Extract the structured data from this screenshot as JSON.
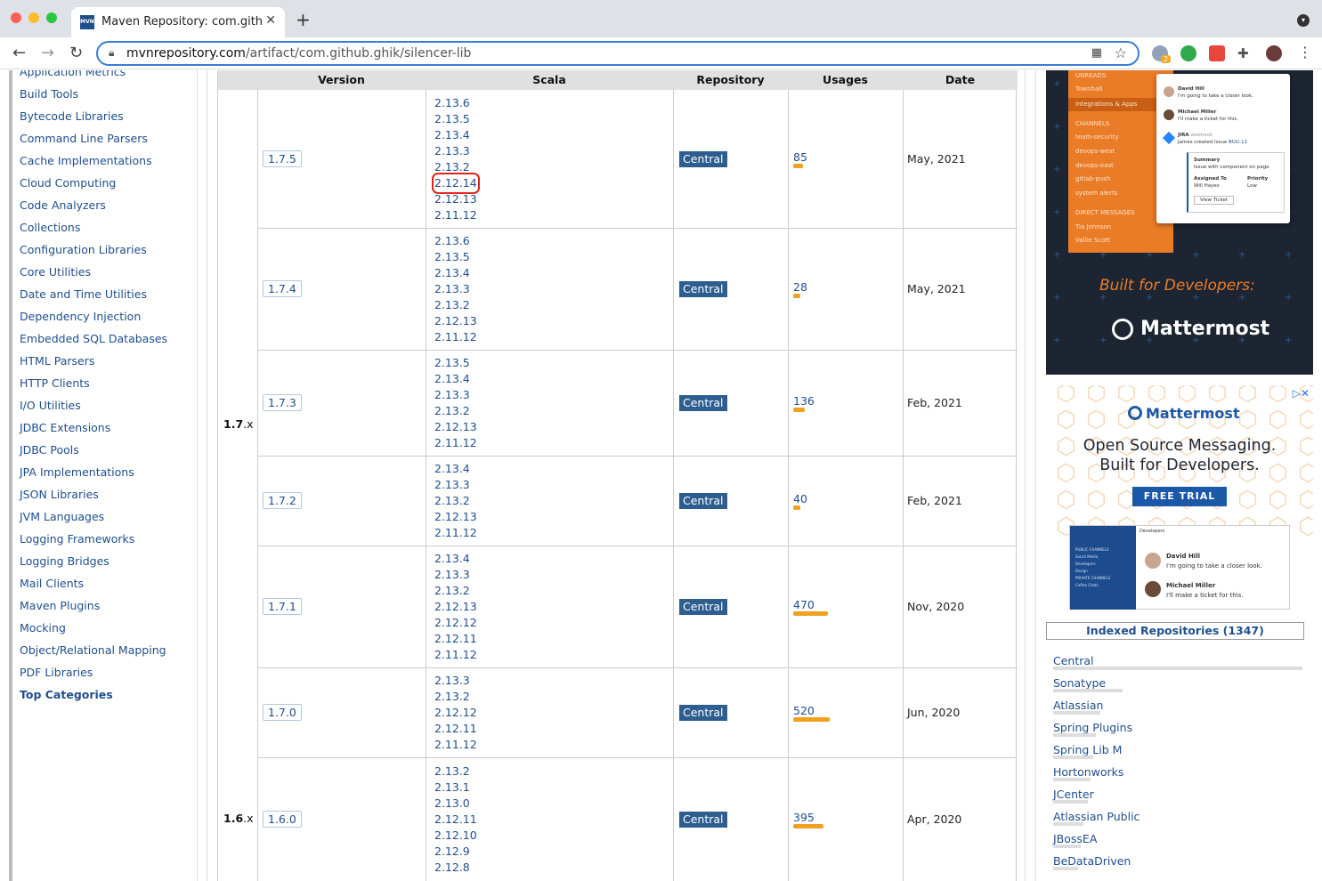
{
  "browser": {
    "tab_title": "Maven Repository: com.github.ghik",
    "favicon": "MVN",
    "url_host": "mvnrepository.com",
    "url_path": "/artifact/com.github.ghik/silencer-lib",
    "extension_badge": "2"
  },
  "sidebar": {
    "items": [
      "Application Metrics",
      "Build Tools",
      "Bytecode Libraries",
      "Command Line Parsers",
      "Cache Implementations",
      "Cloud Computing",
      "Code Analyzers",
      "Collections",
      "Configuration Libraries",
      "Core Utilities",
      "Date and Time Utilities",
      "Dependency Injection",
      "Embedded SQL Databases",
      "HTML Parsers",
      "HTTP Clients",
      "I/O Utilities",
      "JDBC Extensions",
      "JDBC Pools",
      "JPA Implementations",
      "JSON Libraries",
      "JVM Languages",
      "Logging Frameworks",
      "Logging Bridges",
      "Mail Clients",
      "Maven Plugins",
      "Mocking",
      "Object/Relational Mapping",
      "PDF Libraries"
    ],
    "top_categories": "Top Categories"
  },
  "table": {
    "headers": [
      "Version",
      "Scala",
      "Repository",
      "Usages",
      "Date"
    ],
    "groups": [
      {
        "label": "1.7",
        "suffix": ".x"
      },
      {
        "label": "1.6",
        "suffix": ".x"
      }
    ],
    "rows": [
      {
        "version": "1.7.5",
        "scala": [
          "2.13.6",
          "2.13.5",
          "2.13.4",
          "2.13.3",
          "2.13.2",
          "2.12.14",
          "2.12.13",
          "2.11.12"
        ],
        "highlight": "2.12.14",
        "repository": "Central",
        "usages": "85",
        "usage_fraction": 0.025,
        "date": "May, 2021"
      },
      {
        "version": "1.7.4",
        "scala": [
          "2.13.6",
          "2.13.5",
          "2.13.4",
          "2.13.3",
          "2.13.2",
          "2.12.13",
          "2.11.12"
        ],
        "repository": "Central",
        "usages": "28",
        "usage_fraction": 0.015,
        "date": "May, 2021"
      },
      {
        "version": "1.7.3",
        "scala": [
          "2.13.5",
          "2.13.4",
          "2.13.3",
          "2.13.2",
          "2.12.13",
          "2.11.12"
        ],
        "repository": "Central",
        "usages": "136",
        "usage_fraction": 0.03,
        "date": "Feb, 2021"
      },
      {
        "version": "1.7.2",
        "scala": [
          "2.13.4",
          "2.13.3",
          "2.13.2",
          "2.12.13",
          "2.11.12"
        ],
        "repository": "Central",
        "usages": "40",
        "usage_fraction": 0.015,
        "date": "Feb, 2021"
      },
      {
        "version": "1.7.1",
        "scala": [
          "2.13.4",
          "2.13.3",
          "2.13.2",
          "2.12.13",
          "2.12.12",
          "2.12.11",
          "2.11.12"
        ],
        "repository": "Central",
        "usages": "470",
        "usage_fraction": 0.09,
        "date": "Nov, 2020"
      },
      {
        "version": "1.7.0",
        "scala": [
          "2.13.3",
          "2.13.2",
          "2.12.12",
          "2.12.11",
          "2.11.12"
        ],
        "repository": "Central",
        "usages": "520",
        "usage_fraction": 0.095,
        "date": "Jun, 2020"
      },
      {
        "version": "1.6.0",
        "scala": [
          "2.13.2",
          "2.13.1",
          "2.13.0",
          "2.12.11",
          "2.12.10",
          "2.12.9",
          "2.12.8"
        ],
        "repository": "Central",
        "usages": "395",
        "usage_fraction": 0.08,
        "date": "Apr, 2020"
      }
    ]
  },
  "ad_top": {
    "sidebar_labels": [
      "UNREADS",
      "Townhall",
      "Integrations & Apps",
      "CHANNELS",
      "team-security",
      "devops-west",
      "devops-east",
      "gitlab-push",
      "system alerts",
      "DIRECT MESSAGES",
      "Tia Johnson",
      "Vallie Scott"
    ],
    "messages": [
      {
        "name": "David Hill",
        "text": "I'm going to take a closer look."
      },
      {
        "name": "Michael Miller",
        "text": "I'll make a ticket for this."
      }
    ],
    "jira": {
      "name": "JIRA",
      "tag": "webhook",
      "text_prefix": "James created Issue",
      "issue": "BUG-12"
    },
    "ticket": {
      "summary_label": "Summary",
      "summary": "Issue with component on page",
      "assigned_label": "Assigned To",
      "assigned": "Will Hayes",
      "priority_label": "Priority",
      "priority": "Low",
      "button": "View Ticket"
    },
    "tagline": "Built for Developers:",
    "brand": "Mattermost"
  },
  "ad_bottom": {
    "logo": "Mattermost",
    "headline_1": "Open Source Messaging.",
    "headline_2": "Built for Developers.",
    "cta": "FREE TRIAL",
    "channel_title": "Developers",
    "sidebar_labels": [
      "PUBLIC CHANNELS",
      "Social Media",
      "Developers",
      "Design",
      "PRIVATE CHANNELS",
      "Coffee Chats"
    ],
    "messages": [
      {
        "name": "David Hill",
        "text": "I'm going to take a closer look."
      },
      {
        "name": "Michael Miller",
        "text": "I'll make a ticket for this."
      }
    ]
  },
  "repositories": {
    "title": "Indexed Repositories (1347)",
    "items": [
      {
        "name": "Central",
        "share": 1.0
      },
      {
        "name": "Sonatype",
        "share": 0.28
      },
      {
        "name": "Atlassian",
        "share": 0.19
      },
      {
        "name": "Spring Plugins",
        "share": 0.17
      },
      {
        "name": "Spring Lib M",
        "share": 0.16
      },
      {
        "name": "Hortonworks",
        "share": 0.15
      },
      {
        "name": "JCenter",
        "share": 0.14
      },
      {
        "name": "Atlassian Public",
        "share": 0.12
      },
      {
        "name": "JBossEA",
        "share": 0.11
      },
      {
        "name": "BeDataDriven",
        "share": 0.1
      }
    ]
  },
  "colors": {
    "link": "#1f4e8c",
    "repo_badge": "#2e5d8f",
    "usage_bar": "#f0a11f",
    "highlight": "#e0241c",
    "ad_orange": "#ea7b27",
    "ad_dark": "#1d2533"
  }
}
